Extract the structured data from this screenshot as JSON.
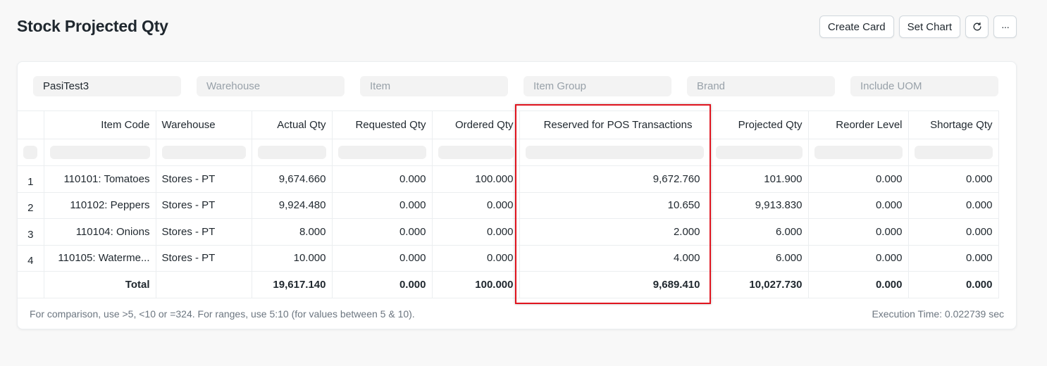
{
  "page": {
    "title": "Stock Projected Qty"
  },
  "toolbar": {
    "create_card": "Create Card",
    "set_chart": "Set Chart",
    "refresh_icon": "refresh-icon",
    "more_icon": "more-icon",
    "more_glyph": "···"
  },
  "filters": {
    "company": "PasiTest3",
    "warehouse": "Warehouse",
    "item": "Item",
    "item_group": "Item Group",
    "brand": "Brand",
    "include_uom": "Include UOM"
  },
  "table": {
    "columns": [
      "Item Code",
      "Warehouse",
      "Actual Qty",
      "Requested Qty",
      "Ordered Qty",
      "Reserved for POS Transactions",
      "Projected Qty",
      "Reorder Level",
      "Shortage Qty"
    ],
    "rows": [
      {
        "idx": "1",
        "item_code": "110101: Tomatoes",
        "warehouse": "Stores - PT",
        "actual": "9,674.660",
        "requested": "0.000",
        "ordered": "100.000",
        "reserved_pos": "9,672.760",
        "projected": "101.900",
        "reorder": "0.000",
        "shortage": "0.000"
      },
      {
        "idx": "2",
        "item_code": "110102: Peppers",
        "warehouse": "Stores - PT",
        "actual": "9,924.480",
        "requested": "0.000",
        "ordered": "0.000",
        "reserved_pos": "10.650",
        "projected": "9,913.830",
        "reorder": "0.000",
        "shortage": "0.000"
      },
      {
        "idx": "3",
        "item_code": "110104: Onions",
        "warehouse": "Stores - PT",
        "actual": "8.000",
        "requested": "0.000",
        "ordered": "0.000",
        "reserved_pos": "2.000",
        "projected": "6.000",
        "reorder": "0.000",
        "shortage": "0.000"
      },
      {
        "idx": "4",
        "item_code": "110105: Waterme...",
        "warehouse": "Stores - PT",
        "actual": "10.000",
        "requested": "0.000",
        "ordered": "0.000",
        "reserved_pos": "4.000",
        "projected": "6.000",
        "reorder": "0.000",
        "shortage": "0.000"
      }
    ],
    "total": {
      "label": "Total",
      "actual": "19,617.140",
      "requested": "0.000",
      "ordered": "100.000",
      "reserved_pos": "9,689.410",
      "projected": "10,027.730",
      "reorder": "0.000",
      "shortage": "0.000"
    }
  },
  "footer": {
    "hint": "For comparison, use >5, <10 or =324. For ranges, use 5:10 (for values between 5 & 10).",
    "execution_time": "Execution Time: 0.022739 sec"
  },
  "colors": {
    "highlight": "#e0141e"
  }
}
